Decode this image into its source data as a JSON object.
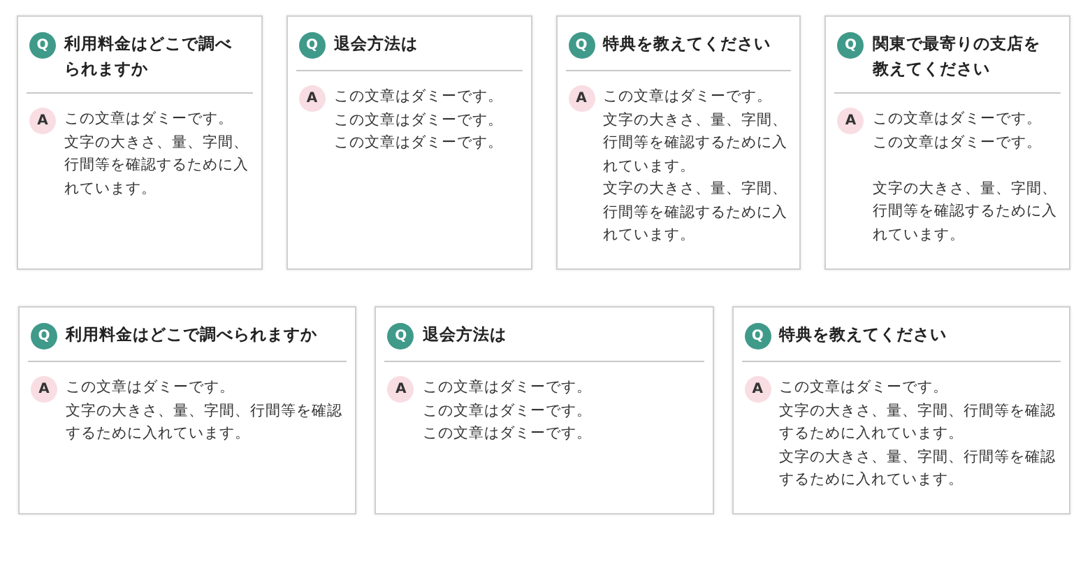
{
  "rows": [
    {
      "cards": [
        {
          "q": "Q",
          "question": "利用料金はどこで調べられますか",
          "a": "A",
          "paragraphs": [
            [
              "この文章はダミーです。",
              "文字の大きさ、量、字間、行間等を確認するために入れています。"
            ]
          ]
        },
        {
          "q": "Q",
          "question": "退会方法は",
          "a": "A",
          "paragraphs": [
            [
              "この文章はダミーです。",
              "この文章はダミーです。",
              "この文章はダミーです。"
            ]
          ]
        },
        {
          "q": "Q",
          "question": "特典を教えてください",
          "a": "A",
          "paragraphs": [
            [
              "この文章はダミーです。",
              "文字の大きさ、量、字間、行間等を確認するために入れています。",
              "文字の大きさ、量、字間、行間等を確認するために入れています。"
            ]
          ]
        },
        {
          "q": "Q",
          "question": "関東で最寄りの支店を教えてください",
          "a": "A",
          "paragraphs": [
            [
              "この文章はダミーです。",
              "この文章はダミーです。"
            ],
            [
              "文字の大きさ、量、字間、行間等を確認するために入れています。"
            ]
          ]
        }
      ]
    },
    {
      "cards": [
        {
          "q": "Q",
          "question": "利用料金はどこで調べられますか",
          "a": "A",
          "paragraphs": [
            [
              "この文章はダミーです。",
              "文字の大きさ、量、字間、行間等を確認するために入れています。"
            ]
          ]
        },
        {
          "q": "Q",
          "question": "退会方法は",
          "a": "A",
          "paragraphs": [
            [
              "この文章はダミーです。",
              "この文章はダミーです。",
              "この文章はダミーです。"
            ]
          ]
        },
        {
          "q": "Q",
          "question": "特典を教えてください",
          "a": "A",
          "paragraphs": [
            [
              "この文章はダミーです。",
              "文字の大きさ、量、字間、行間等を確認するために入れています。",
              "文字の大きさ、量、字間、行間等を確認するために入れています。"
            ]
          ]
        }
      ]
    }
  ]
}
